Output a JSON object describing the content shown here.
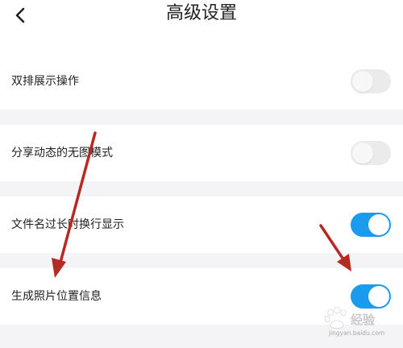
{
  "header": {
    "title": "高级设置"
  },
  "settings": [
    {
      "label": "双排展示操作",
      "enabled": false
    },
    {
      "label": "分享动态的无图模式",
      "enabled": false
    },
    {
      "label": "文件名过长时换行显示",
      "enabled": true
    },
    {
      "label": "生成照片位置信息",
      "enabled": true
    }
  ],
  "icons": {
    "back": "chevron-left-icon",
    "toggle": "toggle-switch"
  },
  "colors": {
    "toggle_on": "#1a9bee",
    "toggle_off": "#ebebeb",
    "annotation_arrow": "#b52a22",
    "background": "#f4f4f6"
  },
  "watermark": {
    "text": "经验",
    "subtext": "jingyan.baidu.com"
  }
}
